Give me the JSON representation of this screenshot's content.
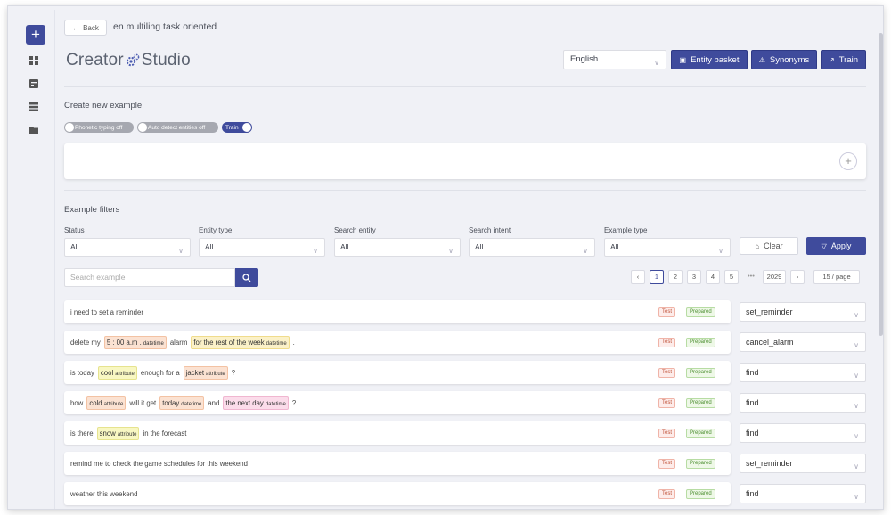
{
  "sidebar": {
    "add_label": "+"
  },
  "header": {
    "back_label": "Back",
    "project_name": "en multiling task oriented"
  },
  "logo": {
    "part1": "Creator",
    "part2": "Studio"
  },
  "toolbar": {
    "language": "English",
    "entity_basket_label": "Entity basket",
    "synonyms_label": "Synonyms",
    "train_label": "Train"
  },
  "create": {
    "title": "Create new example",
    "toggles": [
      {
        "label": "Phonetic typing off",
        "on": false
      },
      {
        "label": "Auto detect entities off",
        "on": false
      },
      {
        "label": "Train",
        "on": true
      }
    ],
    "add_symbol": "+"
  },
  "filters": {
    "title": "Example filters",
    "status": {
      "label": "Status",
      "value": "All"
    },
    "entity_type": {
      "label": "Entity type",
      "value": "All"
    },
    "search_entity": {
      "label": "Search entity",
      "value": "All"
    },
    "search_intent": {
      "label": "Search intent",
      "value": "All"
    },
    "example_type": {
      "label": "Example type",
      "value": "All"
    },
    "clear_label": "Clear",
    "apply_label": "Apply"
  },
  "search": {
    "placeholder": "Search example"
  },
  "pagination": {
    "pages": [
      "1",
      "2",
      "3",
      "4",
      "5"
    ],
    "ellipsis": "•••",
    "last": "2029",
    "per_page": "15 / page"
  },
  "examples": [
    {
      "parts": [
        {
          "t": "i need to set a reminder"
        }
      ],
      "status": "Test",
      "state": "Prepared",
      "intent": "set_reminder"
    },
    {
      "parts": [
        {
          "t": "delete my"
        },
        {
          "e": "5 : 00 a.m .",
          "type": "datetime",
          "c": "dt"
        },
        {
          "t": "alarm"
        },
        {
          "e": "for the rest of the week",
          "type": "datetime",
          "c": "dt2"
        },
        {
          "t": "."
        }
      ],
      "status": "Test",
      "state": "Prepared",
      "intent": "cancel_alarm"
    },
    {
      "parts": [
        {
          "t": "is today"
        },
        {
          "e": "cool",
          "type": "attribute",
          "c": "attr"
        },
        {
          "t": "enough for a"
        },
        {
          "e": "jacket",
          "type": "attribute",
          "c": "attr2"
        },
        {
          "t": "?"
        }
      ],
      "status": "Test",
      "state": "Prepared",
      "intent": "find"
    },
    {
      "parts": [
        {
          "t": "how"
        },
        {
          "e": "cold",
          "type": "attribute",
          "c": "attr2"
        },
        {
          "t": "will it get"
        },
        {
          "e": "today",
          "type": "datetime",
          "c": "dt"
        },
        {
          "t": "and"
        },
        {
          "e": "the next day",
          "type": "datetime",
          "c": "dt3"
        },
        {
          "t": "?"
        }
      ],
      "status": "Test",
      "state": "Prepared",
      "intent": "find"
    },
    {
      "parts": [
        {
          "t": "is there"
        },
        {
          "e": "snow",
          "type": "attribute",
          "c": "attr"
        },
        {
          "t": "in the forecast"
        }
      ],
      "status": "Test",
      "state": "Prepared",
      "intent": "find"
    },
    {
      "parts": [
        {
          "t": "remind me to check the game schedules for this weekend"
        }
      ],
      "status": "Test",
      "state": "Prepared",
      "intent": "set_reminder"
    },
    {
      "parts": [
        {
          "t": "weather this weekend"
        }
      ],
      "status": "Test",
      "state": "Prepared",
      "intent": "find"
    }
  ],
  "colors": {
    "primary": "#3f4b9c",
    "test": "#c0533a",
    "prepared": "#4d8f31"
  }
}
